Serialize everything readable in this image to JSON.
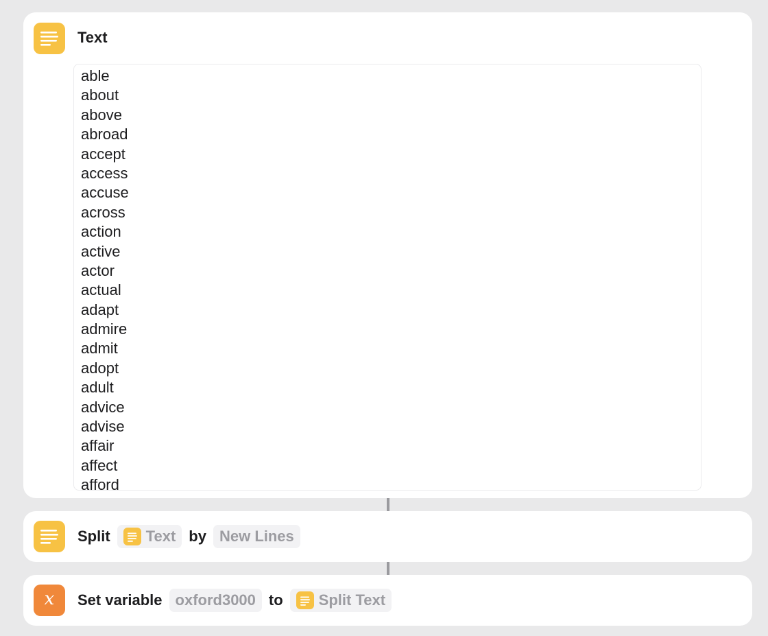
{
  "text_action": {
    "title": "Text",
    "icon": "text-lines-icon",
    "words": [
      "able",
      "about",
      "above",
      "abroad",
      "accept",
      "access",
      "accuse",
      "across",
      "action",
      "active",
      "actor",
      "actual",
      "adapt",
      "admire",
      "admit",
      "adopt",
      "adult",
      "advice",
      "advise",
      "affair",
      "affect",
      "afford"
    ]
  },
  "split_action": {
    "verb": "Split",
    "input_token": "Text",
    "connector": "by",
    "separator": "New Lines",
    "icon": "text-lines-icon"
  },
  "set_variable_action": {
    "verb": "Set variable",
    "variable_name": "oxford3000",
    "connector": "to",
    "value_token": "Split Text",
    "icon": "variable-x-icon"
  },
  "colors": {
    "background": "#e9e9ea",
    "card": "#ffffff",
    "text_action_accent": "#f7c244",
    "variable_accent": "#f0883a",
    "pill_background": "#f2f2f4",
    "pill_text": "#9c9ca1"
  }
}
